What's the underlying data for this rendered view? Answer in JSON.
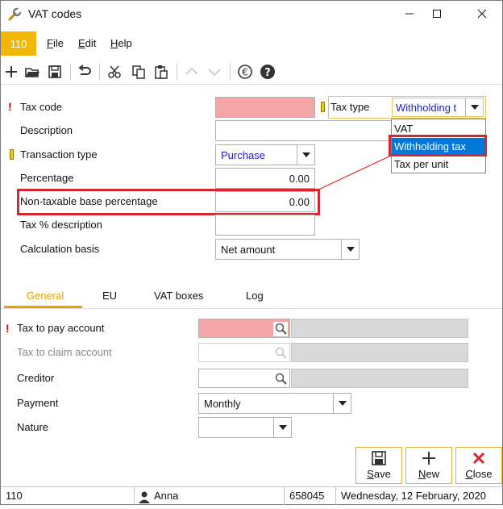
{
  "window": {
    "title": "VAT codes",
    "company": "110"
  },
  "menu": [
    {
      "u": "F",
      "rest": "ile"
    },
    {
      "u": "E",
      "rest": "dit"
    },
    {
      "u": "H",
      "rest": "elp"
    }
  ],
  "form": {
    "tax_code_label": "Tax code",
    "tax_code_value": "",
    "description_label": "Description",
    "description_value": "",
    "transaction_type_label": "Transaction type",
    "transaction_type_value": "Purchase",
    "percentage_label": "Percentage",
    "percentage_value": "0.00",
    "nontaxable_label": "Non-taxable base percentage",
    "nontaxable_value": "0.00",
    "tax_pct_desc_label": "Tax % description",
    "tax_pct_desc_value": "",
    "calc_basis_label": "Calculation basis",
    "calc_basis_value": "Net amount",
    "tax_type_label": "Tax type",
    "tax_type_value": "Withholding t",
    "tax_type_options": [
      "VAT",
      "Withholding tax",
      "Tax per unit"
    ]
  },
  "tabs": [
    "General",
    "EU",
    "VAT boxes",
    "Log"
  ],
  "general": {
    "tax_to_pay_label": "Tax to pay account",
    "tax_to_claim_label": "Tax to claim account",
    "creditor_label": "Creditor",
    "payment_label": "Payment",
    "payment_value": "Monthly",
    "nature_label": "Nature",
    "nature_value": ""
  },
  "actions": {
    "save": {
      "u": "S",
      "rest": "ave"
    },
    "new": {
      "u": "N",
      "rest": "ew"
    },
    "close": {
      "u": "C",
      "rest": "lose"
    }
  },
  "status": {
    "company": "110",
    "user": "Anna",
    "number": "658045",
    "date": "Wednesday, 12 February, 2020"
  },
  "colors": {
    "accent": "#f2b705",
    "required_bg": "#f4a6a6",
    "highlight_border": "#d6262f",
    "selection": "#0078d7"
  }
}
